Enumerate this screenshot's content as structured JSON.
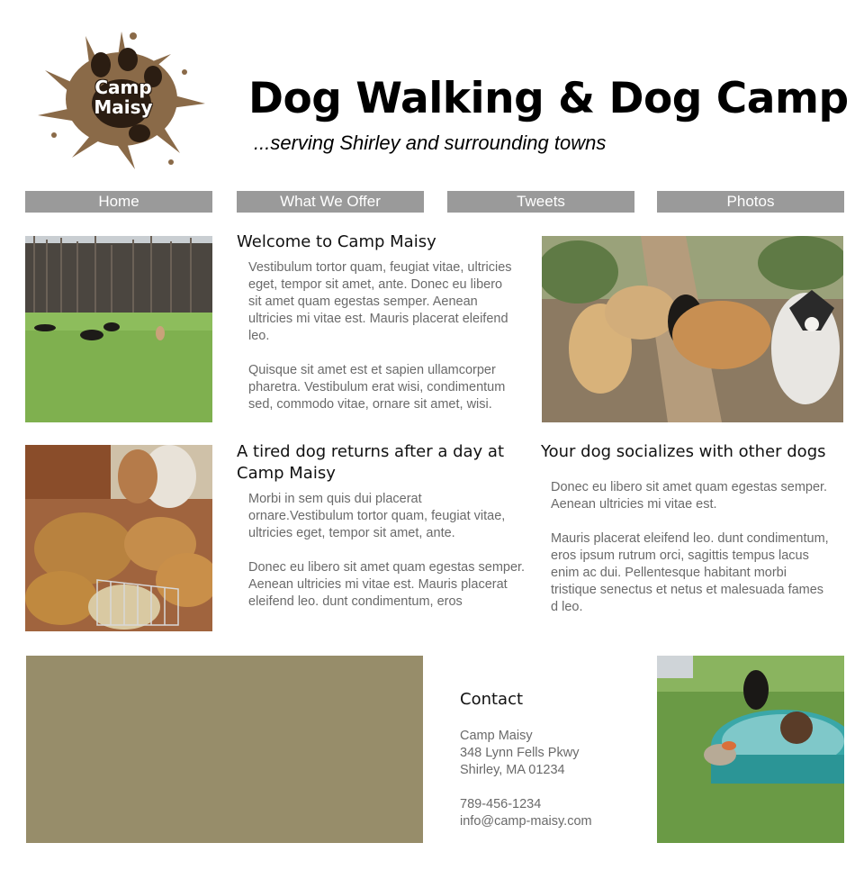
{
  "header": {
    "logo_text_line1": "Camp",
    "logo_text_line2": "Maisy",
    "title": "Dog Walking & Dog Camp",
    "tagline": "...serving Shirley and surrounding towns"
  },
  "nav": {
    "items": [
      {
        "label": "Home"
      },
      {
        "label": "What We Offer"
      },
      {
        "label": "Tweets"
      },
      {
        "label": "Photos"
      }
    ]
  },
  "section_welcome": {
    "heading": "Welcome to Camp Maisy",
    "para1": "Vestibulum tortor quam, feugiat vitae, ultricies eget, tempor sit amet, ante. Donec eu libero sit amet quam egestas semper. Aenean ultricies mi vitae est. Mauris placerat eleifend leo.",
    "para2": "Quisque sit amet est et sapien ullamcorper pharetra. Vestibulum erat wisi, condimentum sed, commodo vitae, ornare sit amet, wisi."
  },
  "section_tired": {
    "heading": "A tired dog returns after a day at Camp Maisy",
    "para1": "Morbi in sem quis dui placerat ornare.Vestibulum tortor quam, feugiat vitae, ultricies eget, tempor sit amet, ante.",
    "para2": "Donec eu libero sit amet quam egestas semper. Aenean ultricies mi vitae est. Mauris placerat eleifend leo. dunt condimentum, eros"
  },
  "section_socialize": {
    "heading": "Your dog socializes with other dogs",
    "para1": "Donec eu libero sit amet quam egestas semper. Aenean ultricies mi vitae est.",
    "para2": "Mauris placerat eleifend leo. dunt condimentum, eros ipsum rutrum orci, sagittis tempus lacus enim ac dui.  Pellentesque habitant morbi tristique senectus et netus et malesuada fames d leo."
  },
  "contact": {
    "heading": "Contact",
    "name": "Camp Maisy",
    "street": "348 Lynn Fells Pkwy",
    "city": "Shirley, MA  01234",
    "phone": "789-456-1234",
    "email": "info@camp-maisy.com"
  },
  "colors": {
    "nav_bg": "#9a9a9a",
    "map_placeholder": "#978d6a",
    "logo_splat": "#8a6a48"
  }
}
